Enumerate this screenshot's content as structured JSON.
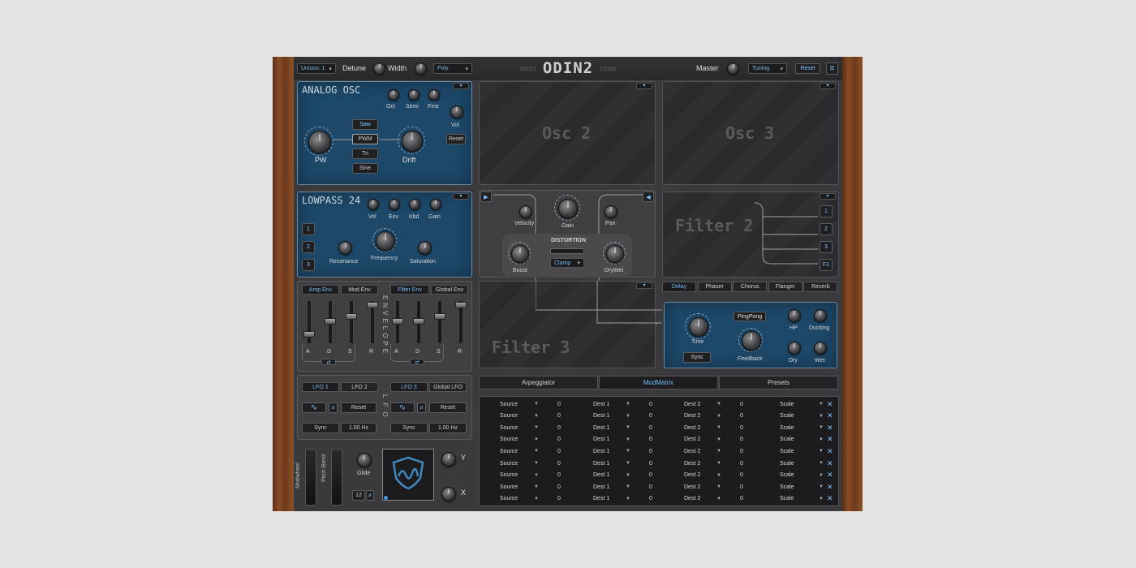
{
  "header": {
    "unison": "Unison: 1",
    "detune_label": "Detune",
    "width_label": "Width",
    "voice_mode": "Poly",
    "logo": "ODIN2",
    "master_label": "Master",
    "tuning": "Tuning",
    "reset": "Reset",
    "menu_icon": "hamburger-icon"
  },
  "osc1": {
    "title": "ANALOG OSC",
    "knobs": {
      "oct": "Oct",
      "semi": "Semi",
      "fine": "Fine",
      "vol": "Vol",
      "pw": "PW",
      "drift": "Drift"
    },
    "waves": [
      "Saw",
      "PWM",
      "Tri",
      "Sine"
    ],
    "selected_wave": "PWM",
    "reset": "Reset"
  },
  "osc2": {
    "title": "Osc 2"
  },
  "osc3": {
    "title": "Osc 3"
  },
  "filter1": {
    "title": "LOWPASS 24",
    "knobs": {
      "vel": "Vel",
      "env": "Env",
      "kbd": "Kbd",
      "gain": "Gain",
      "resonance": "Resonance",
      "frequency": "Frequency",
      "saturation": "Saturation"
    },
    "inputs": [
      "1",
      "2",
      "3"
    ]
  },
  "filter2": {
    "title": "Filter 2",
    "inputs": [
      "1",
      "2",
      "3",
      "F1"
    ]
  },
  "filter3": {
    "title": "Filter 3"
  },
  "routing": {
    "velocity": "Velocity",
    "gain": "Gain",
    "pan": "Pan",
    "distortion": "DISTORTION",
    "boost": "Boost",
    "drywet": "DryWet",
    "dist_type": "Clamp"
  },
  "envelopes": {
    "left_tabs": [
      "Amp Env",
      "Mod Env"
    ],
    "right_tabs": [
      "Filter Env",
      "Global Env"
    ],
    "left_active": "Amp Env",
    "right_active": "Filter Env",
    "label": "ENVELOPE",
    "adsr": [
      "A",
      "D",
      "S",
      "R"
    ]
  },
  "lfo": {
    "left_tabs": [
      "LFO 1",
      "LFO 2"
    ],
    "right_tabs": [
      "LFO 3",
      "Global LFO"
    ],
    "left_active": "LFO 1",
    "right_active": "LFO 3",
    "label": "LFO",
    "reset": "Reset",
    "sync": "Sync",
    "rate": "1.00 Hz"
  },
  "controls": {
    "modwheel": "Modwheel",
    "pitchbend": "Pitch Bend",
    "glide": "Glide",
    "pitch_range": "12",
    "xy_x": "X",
    "xy_y": "Y"
  },
  "fx": {
    "tabs": [
      "Delay",
      "Phaser",
      "Chorus",
      "Flanger",
      "Reverb"
    ],
    "active": "Delay",
    "pingpong": "PingPong",
    "time": "Time",
    "feedback": "Feedback",
    "hp": "HP",
    "ducking": "Ducking",
    "dry": "Dry",
    "wet": "Wet",
    "sync": "Sync"
  },
  "bottom_tabs": {
    "items": [
      "Arpeggiator",
      "ModMatrix",
      "Presets"
    ],
    "active": "ModMatrix"
  },
  "modmatrix": {
    "rows": [
      {
        "source": "Source",
        "amt1": "0",
        "dest1": "Dest 1",
        "amt2": "0",
        "dest2": "Dest 2",
        "amt3": "0",
        "scale": "Scale"
      },
      {
        "source": "Source",
        "amt1": "0",
        "dest1": "Dest 1",
        "amt2": "0",
        "dest2": "Dest 2",
        "amt3": "0",
        "scale": "Scale"
      },
      {
        "source": "Source",
        "amt1": "0",
        "dest1": "Dest 1",
        "amt2": "0",
        "dest2": "Dest 2",
        "amt3": "0",
        "scale": "Scale"
      },
      {
        "source": "Source",
        "amt1": "0",
        "dest1": "Dest 1",
        "amt2": "0",
        "dest2": "Dest 2",
        "amt3": "0",
        "scale": "Scale"
      },
      {
        "source": "Source",
        "amt1": "0",
        "dest1": "Dest 1",
        "amt2": "0",
        "dest2": "Dest 2",
        "amt3": "0",
        "scale": "Scale"
      },
      {
        "source": "Source",
        "amt1": "0",
        "dest1": "Dest 1",
        "amt2": "0",
        "dest2": "Dest 2",
        "amt3": "0",
        "scale": "Scale"
      },
      {
        "source": "Source",
        "amt1": "0",
        "dest1": "Dest 1",
        "amt2": "0",
        "dest2": "Dest 2",
        "amt3": "0",
        "scale": "Scale"
      },
      {
        "source": "Source",
        "amt1": "0",
        "dest1": "Dest 1",
        "amt2": "0",
        "dest2": "Dest 2",
        "amt3": "0",
        "scale": "Scale"
      },
      {
        "source": "Source",
        "amt1": "0",
        "dest1": "Dest 1",
        "amt2": "0",
        "dest2": "Dest 2",
        "amt3": "0",
        "scale": "Scale"
      }
    ]
  },
  "colors": {
    "accent": "#7fc4ff",
    "panel_blue": "#1d4869",
    "wood": "#7a4220"
  }
}
